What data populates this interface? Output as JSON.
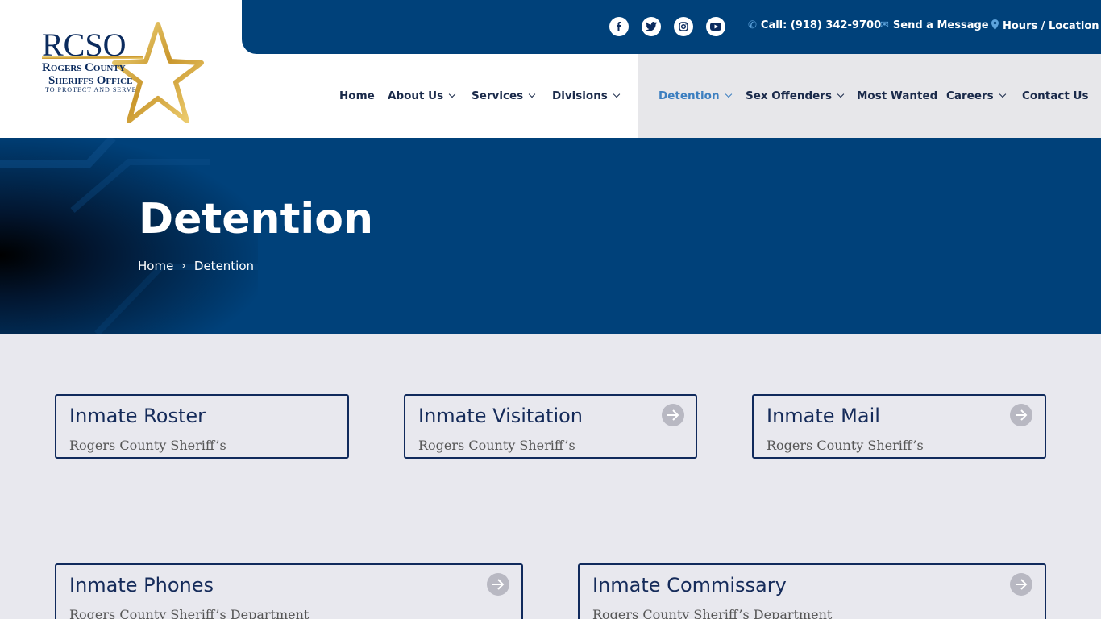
{
  "logo": {
    "acronym": "RCSO",
    "line1": "Rogers County",
    "line2": "Sheriffs Office",
    "tagline": "TO PROTECT AND SERVE"
  },
  "topbar": {
    "social": [
      {
        "icon": "facebook-icon"
      },
      {
        "icon": "twitter-icon"
      },
      {
        "icon": "instagram-icon"
      },
      {
        "icon": "youtube-icon"
      }
    ],
    "phone": "Call: (918) 342-9700",
    "message": "Send a Message",
    "hours": "Hours / Location"
  },
  "nav": {
    "home": "Home",
    "about": "About Us",
    "services": "Services",
    "divisions": "Divisions",
    "detention": "Detention",
    "sex_offenders": "Sex Offenders",
    "most_wanted": "Most Wanted",
    "careers": "Careers",
    "contact": "Contact Us"
  },
  "hero": {
    "title": "Detention",
    "breadcrumb_home": "Home",
    "breadcrumb_sep": "›",
    "breadcrumb_current": "Detention"
  },
  "cards": [
    {
      "title": "Inmate Roster",
      "subtitle": "Rogers County Sheriff’s"
    },
    {
      "title": "Inmate Visitation",
      "subtitle": "Rogers County Sheriff’s"
    },
    {
      "title": "Inmate Mail",
      "subtitle": "Rogers County Sheriff’s"
    },
    {
      "title": "Inmate Phones",
      "subtitle": "Rogers County Sheriff’s Department"
    },
    {
      "title": "Inmate Commissary",
      "subtitle": "Rogers County Sheriff’s Department"
    }
  ],
  "colors": {
    "navy": "#00417a",
    "card_border": "#102a5c",
    "active_nav": "#3c7fc0",
    "page_bg": "#e8e8ee",
    "gold": "#d4a83a"
  }
}
